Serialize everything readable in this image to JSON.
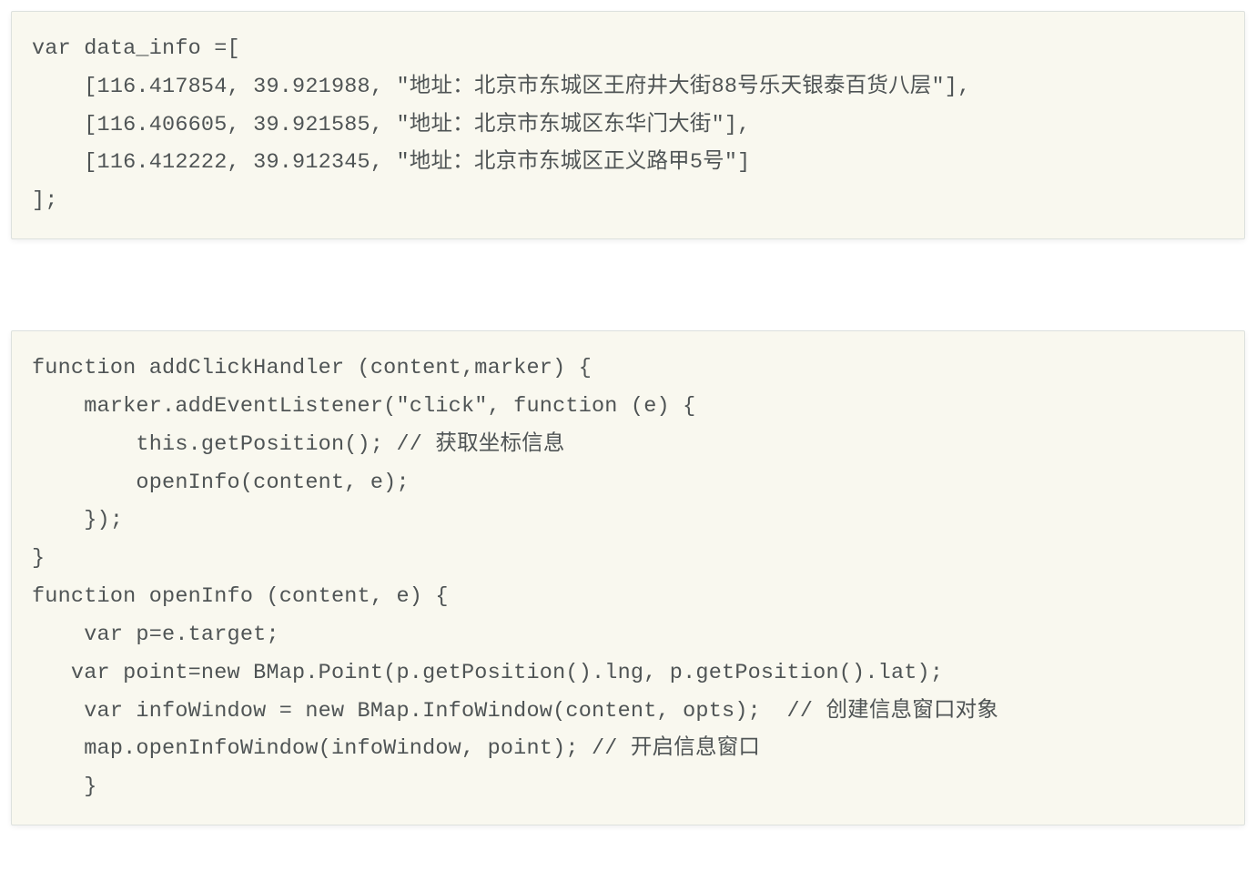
{
  "blocks": [
    {
      "code": "var data_info =[\n    [116.417854, 39.921988, \"地址：北京市东城区王府井大街88号乐天银泰百货八层\"],\n    [116.406605, 39.921585, \"地址：北京市东城区东华门大街\"],\n    [116.412222, 39.912345, \"地址：北京市东城区正义路甲5号\"]\n];"
    },
    {
      "code": "function addClickHandler (content,marker) {\n    marker.addEventListener(\"click\", function (e) {\n        this.getPosition(); // 获取坐标信息\n        openInfo(content, e);\n    });\n}\nfunction openInfo (content, e) {\n    var p=e.target;\n   var point=new BMap.Point(p.getPosition().lng, p.getPosition().lat);\n    var infoWindow = new BMap.InfoWindow(content, opts);  // 创建信息窗口对象\n    map.openInfoWindow(infoWindow, point); // 开启信息窗口\n    }"
    }
  ]
}
